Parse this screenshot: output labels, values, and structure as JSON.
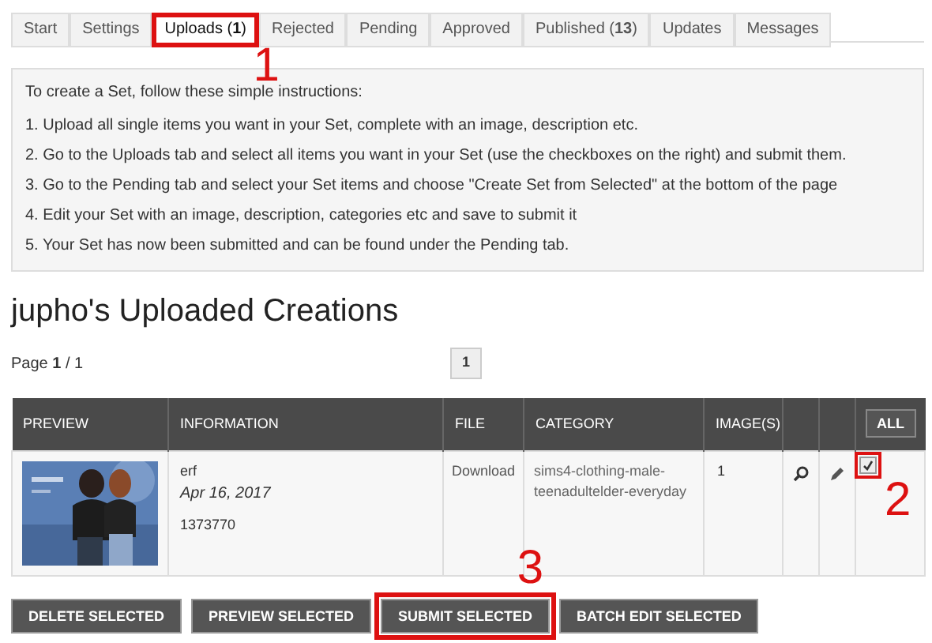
{
  "tabs": [
    {
      "label": "Start",
      "selected": false
    },
    {
      "label": "Settings",
      "selected": false
    },
    {
      "label": "Uploads (**1**)",
      "selected": true,
      "callout": "1"
    },
    {
      "label": "Rejected",
      "selected": false
    },
    {
      "label": "Pending",
      "selected": false
    },
    {
      "label": "Approved",
      "selected": false
    },
    {
      "label": "Published (**13**)",
      "selected": false
    },
    {
      "label": "Updates",
      "selected": false
    },
    {
      "label": "Messages",
      "selected": false
    }
  ],
  "instructions": {
    "intro": "To create a Set, follow these simple instructions:",
    "steps": [
      "1. Upload all single items you want in your Set, complete with an image, description etc.",
      "2. Go to the Uploads tab and select all items you want in your Set (use the checkboxes on the right) and submit them.",
      "3. Go to the Pending tab and select your Set items and choose \"Create Set from Selected\" at the bottom of the page",
      "4. Edit your Set with an image, description, categories etc and save to submit it",
      "5. Your Set has now been submitted and can be found under the Pending tab."
    ]
  },
  "heading": "jupho's Uploaded Creations",
  "pagination": {
    "label": "Page **1** / 1",
    "pages": [
      {
        "label": "1",
        "selected": true
      }
    ]
  },
  "table": {
    "columns": [
      "PREVIEW",
      "INFORMATION",
      "FILE",
      "CATEGORY",
      "IMAGE(S)"
    ],
    "select_all": "ALL",
    "rows": [
      {
        "title": "erf",
        "date": "Apr 16, 2017",
        "id": "1373770",
        "file": "Download",
        "category": "sims4-clothing-male-teenadultelder-everyday",
        "images": "1",
        "checked": true,
        "callout": "2"
      }
    ]
  },
  "buttons": [
    {
      "label": "DELETE SELECTED"
    },
    {
      "label": "PREVIEW SELECTED"
    },
    {
      "label": "SUBMIT SELECTED",
      "callout": "3"
    },
    {
      "label": "BATCH EDIT SELECTED"
    }
  ]
}
